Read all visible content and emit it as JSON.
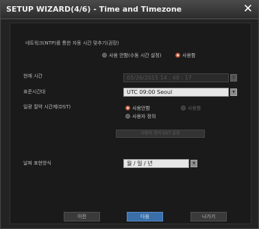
{
  "window": {
    "title": "SETUP WIZARD(4/6) - Time and Timezone",
    "close_glyph": "✕"
  },
  "ntp": {
    "label": "네트워크(NTP)를 통한 자동 시간 맞추기(권장)",
    "option_off": "사용 안함(수동 시간 설정)",
    "option_on": "사용함"
  },
  "current_time": {
    "label": "현재 시간",
    "value": "05/26/2015  14 : 48 : 17"
  },
  "timezone": {
    "label": "표준시간대",
    "value": "UTC 09:00 Seoul"
  },
  "dst": {
    "label": "일광 절약 시간제(DST)",
    "option_off": "사용안함",
    "option_on": "사용함",
    "option_custom": "사용자 정의",
    "settings_button": "사용자 정의 DST 설정"
  },
  "date_format": {
    "label": "날짜 표현방식",
    "value": "월 / 일 / 년"
  },
  "footer": {
    "prev": "이전",
    "next": "다음",
    "exit": "나가기"
  },
  "icons": {
    "dropdown": "▾",
    "spinner": "⇕"
  },
  "colors": {
    "active_button": "#3a6ea8",
    "radio_selected_ring": "#c85a3a"
  }
}
